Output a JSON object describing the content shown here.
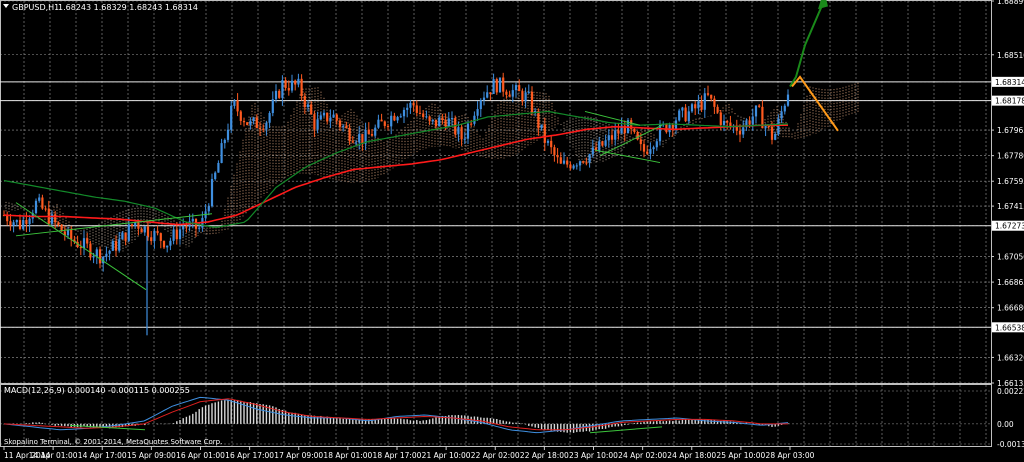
{
  "window": {
    "symbol_header": "GBPUSD,H1",
    "ohlc_header": "1.68243 1.68329 1.68243 1.68314",
    "menu_arrow_icon": "triangle-down-icon"
  },
  "watermark": "Skopalino Terminal, © 2001-2014, MetaQuotes Software Corp.",
  "colors": {
    "background": "#000000",
    "grid": "#9a9a9a",
    "bull_candle": "#3f8fe0",
    "bear_candle": "#ff5a1f",
    "doji": "#ffffff",
    "ma_slow": "#ff1a1a",
    "ma_fast": "#138a2a",
    "cloud_a": "#f1b48a",
    "cloud_b": "#d8c0ac",
    "trend_lines": "#3cc43c",
    "projection_up": "#1a8a1a",
    "projection_down": "#ff9a1a",
    "macd_hist": "#d8d8d8",
    "macd_main": "#3f8fe0",
    "macd_signal": "#e02020"
  },
  "chart_data": [
    {
      "type": "candlestick",
      "title": "GBPUSD,H1",
      "y_axis_ticks": [
        "1.68899",
        "1.68510",
        "1.68314",
        "1.68178",
        "1.67965",
        "1.67780",
        "1.67595",
        "1.67415",
        "1.67273",
        "1.67050",
        "1.66865",
        "1.66680",
        "1.66538",
        "1.66320",
        "1.66135"
      ],
      "ylim": [
        1.66135,
        1.68899
      ],
      "x_axis_ticks": [
        "11 Apr 2014",
        "14 Apr 01:00",
        "14 Apr 17:00",
        "15 Apr 09:00",
        "16 Apr 01:00",
        "16 Apr 17:00",
        "17 Apr 09:00",
        "18 Apr 01:00",
        "18 Apr 17:00",
        "21 Apr 10:00",
        "22 Apr 02:00",
        "22 Apr 18:00",
        "23 Apr 10:00",
        "24 Apr 02:00",
        "24 Apr 18:00",
        "25 Apr 10:00",
        "28 Apr 03:00"
      ],
      "price_tags": [
        {
          "label": "1.68314",
          "value": 1.68314
        },
        {
          "label": "1.68178",
          "value": 1.68178
        },
        {
          "label": "1.67273",
          "value": 1.67273
        },
        {
          "label": "1.66538",
          "value": 1.66538
        }
      ],
      "horizontal_lines": [
        1.68314,
        1.68178,
        1.67273,
        1.66538
      ],
      "series": [
        {
          "kind": "candles",
          "anchors_close": [
            1.6735,
            1.6728,
            1.6744,
            1.673,
            1.6718,
            1.6712,
            1.6705,
            1.6715,
            1.673,
            1.6722,
            1.6715,
            1.6728,
            1.6725,
            1.6768,
            1.6815,
            1.68,
            1.6803,
            1.683,
            1.6828,
            1.68,
            1.6808,
            1.6795,
            1.679,
            1.68,
            1.681,
            1.6815,
            1.68,
            1.6805,
            1.679,
            1.682,
            1.683,
            1.6825,
            1.682,
            1.679,
            1.677,
            1.6775,
            1.678,
            1.679,
            1.68,
            1.678,
            1.6795,
            1.6805,
            1.681,
            1.682,
            1.68,
            1.6798,
            1.681,
            1.679,
            1.683
          ]
        },
        {
          "kind": "ma_slow",
          "values": [
            1.6735,
            1.6734,
            1.6734,
            1.6733,
            1.6732,
            1.673,
            1.6728,
            1.673,
            1.6735,
            1.6745,
            1.6755,
            1.6762,
            1.6768,
            1.677,
            1.6772,
            1.6775,
            1.678,
            1.6785,
            1.679,
            1.6793,
            1.6797,
            1.6799,
            1.6798,
            1.6797,
            1.6798,
            1.6799,
            1.68,
            1.68
          ]
        },
        {
          "kind": "ma_fast",
          "values": [
            1.676,
            1.6756,
            1.6752,
            1.6748,
            1.6745,
            1.674,
            1.673,
            1.6726,
            1.673,
            1.6755,
            1.677,
            1.678,
            1.6788,
            1.6792,
            1.6796,
            1.68,
            1.6806,
            1.6808,
            1.681,
            1.6806,
            1.6802,
            1.68,
            1.6801,
            1.68,
            1.6799,
            1.68,
            1.6801
          ]
        }
      ],
      "trend_lines_count": 5,
      "grid": true
    },
    {
      "type": "bar+line",
      "title": "MACD(12,26,9) 0.000140 -0.000115 0.000255",
      "y_axis_ticks": [
        "0.00222",
        "0.00",
        "-0.00136"
      ],
      "ylim": [
        -0.00136,
        0.00222
      ],
      "series": [
        {
          "kind": "histogram",
          "values": [
            0.0,
            0.0,
            0.0001,
            -0.0001,
            -0.0002,
            -0.0002,
            -0.0003,
            -0.0002,
            -0.0001,
            0.0,
            0.0,
            0.0005,
            0.0012,
            0.0016,
            0.0016,
            0.0014,
            0.0012,
            0.0008,
            0.0006,
            0.0005,
            0.0004,
            0.0003,
            0.0003,
            0.0004,
            0.0003,
            0.0002,
            0.0005,
            0.0006,
            0.0005,
            0.0004,
            0.0002,
            0.0,
            -0.0003,
            -0.0005,
            -0.0006,
            -0.0005,
            -0.0003,
            -0.0001,
            0.0001,
            0.0002,
            0.0002,
            0.0003,
            0.0003,
            0.0002,
            0.0001,
            0.0,
            -0.0002,
            0.0001
          ]
        },
        {
          "kind": "main",
          "values": [
            0.0,
            -0.0002,
            -0.0004,
            -0.0003,
            -0.0001,
            0.0002,
            0.0012,
            0.0018,
            0.0016,
            0.001,
            0.0006,
            0.0004,
            0.0004,
            0.0002,
            0.0005,
            0.0006,
            0.0004,
            0.0001,
            -0.0004,
            -0.0006,
            -0.0004,
            -0.0001,
            0.0002,
            0.0003,
            0.0004,
            0.0002,
            0.0001,
            -0.0001,
            0.0001
          ]
        },
        {
          "kind": "signal",
          "values": [
            0.0,
            -0.0001,
            -0.0002,
            -0.0003,
            -0.0002,
            0.0,
            0.0008,
            0.0015,
            0.0017,
            0.0013,
            0.0008,
            0.0005,
            0.0004,
            0.0003,
            0.0004,
            0.0005,
            0.0004,
            0.0002,
            -0.0002,
            -0.0004,
            -0.0004,
            -0.0002,
            0.0001,
            0.0002,
            0.0003,
            0.0003,
            0.0002,
            0.0,
            0.0
          ]
        }
      ]
    }
  ]
}
